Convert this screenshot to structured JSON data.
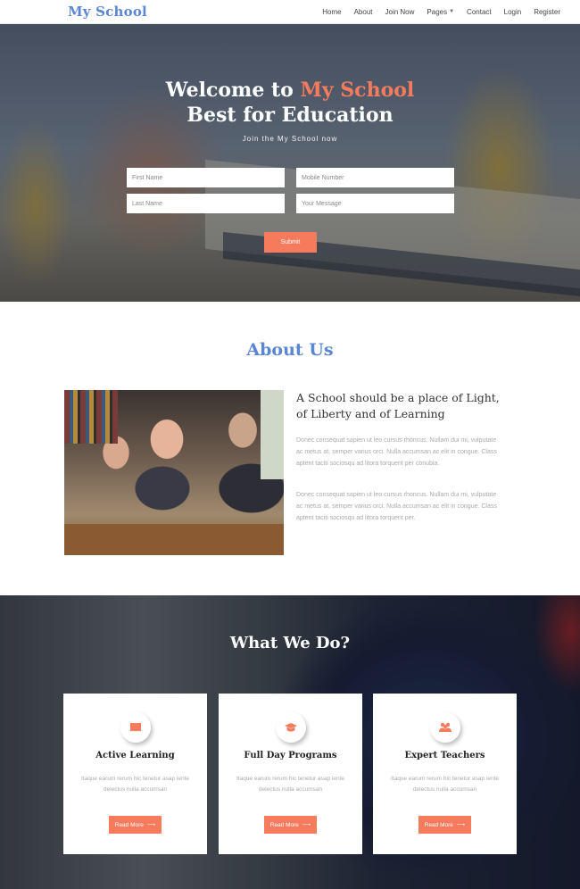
{
  "nav": {
    "brand": "My School",
    "items": [
      "Home",
      "About",
      "Join Now",
      "Pages",
      "Contact",
      "Login",
      "Register"
    ]
  },
  "hero": {
    "title_prefix": "Welcome to ",
    "title_accent": "My School",
    "title_line2": "Best for Education",
    "subtitle": "Join the My School now",
    "fields": {
      "first_name": "First Name",
      "mobile": "Mobile Number",
      "last_name": "Last Name",
      "message": "Your Message"
    },
    "submit": "Submit"
  },
  "about": {
    "title": "About Us",
    "heading": "A School should be a place of Light, of Liberty and of Learning",
    "p1": "Donec consequat sapien ut leo cursus rhoncus. Nullam dui mi, vulputate ac metus at, semper varius orci. Nulla accumsan ac elit in congue. Class aptent taciti sociosqu ad litora torquent per conubia.",
    "p2": "Donec consequat sapien ut leo cursus rhoncus. Nullam dui mi, vulputate ac metus at, semper varius orci. Nulla accumsan ac elit in congue. Class aptent taciti sociosqu ad litora torquent per."
  },
  "services": {
    "title": "What We Do?",
    "cards": [
      {
        "icon": "book-icon",
        "title": "Active Learning",
        "text": "Itaque earum rerum hic tenetur asap iente delectus nulla accumsan",
        "button": "Read More"
      },
      {
        "icon": "graduation-cap-icon",
        "title": "Full Day Programs",
        "text": "Itaque earum rerum hic tenetur asap iente delectus nulla accumsan",
        "button": "Read More"
      },
      {
        "icon": "users-icon",
        "title": "Expert Teachers",
        "text": "Itaque earum rerum hic tenetur asap iente delectus nulla accumsan",
        "button": "Read More"
      }
    ]
  },
  "colors": {
    "accent": "#f67b5d",
    "brand": "#5b86d4"
  }
}
